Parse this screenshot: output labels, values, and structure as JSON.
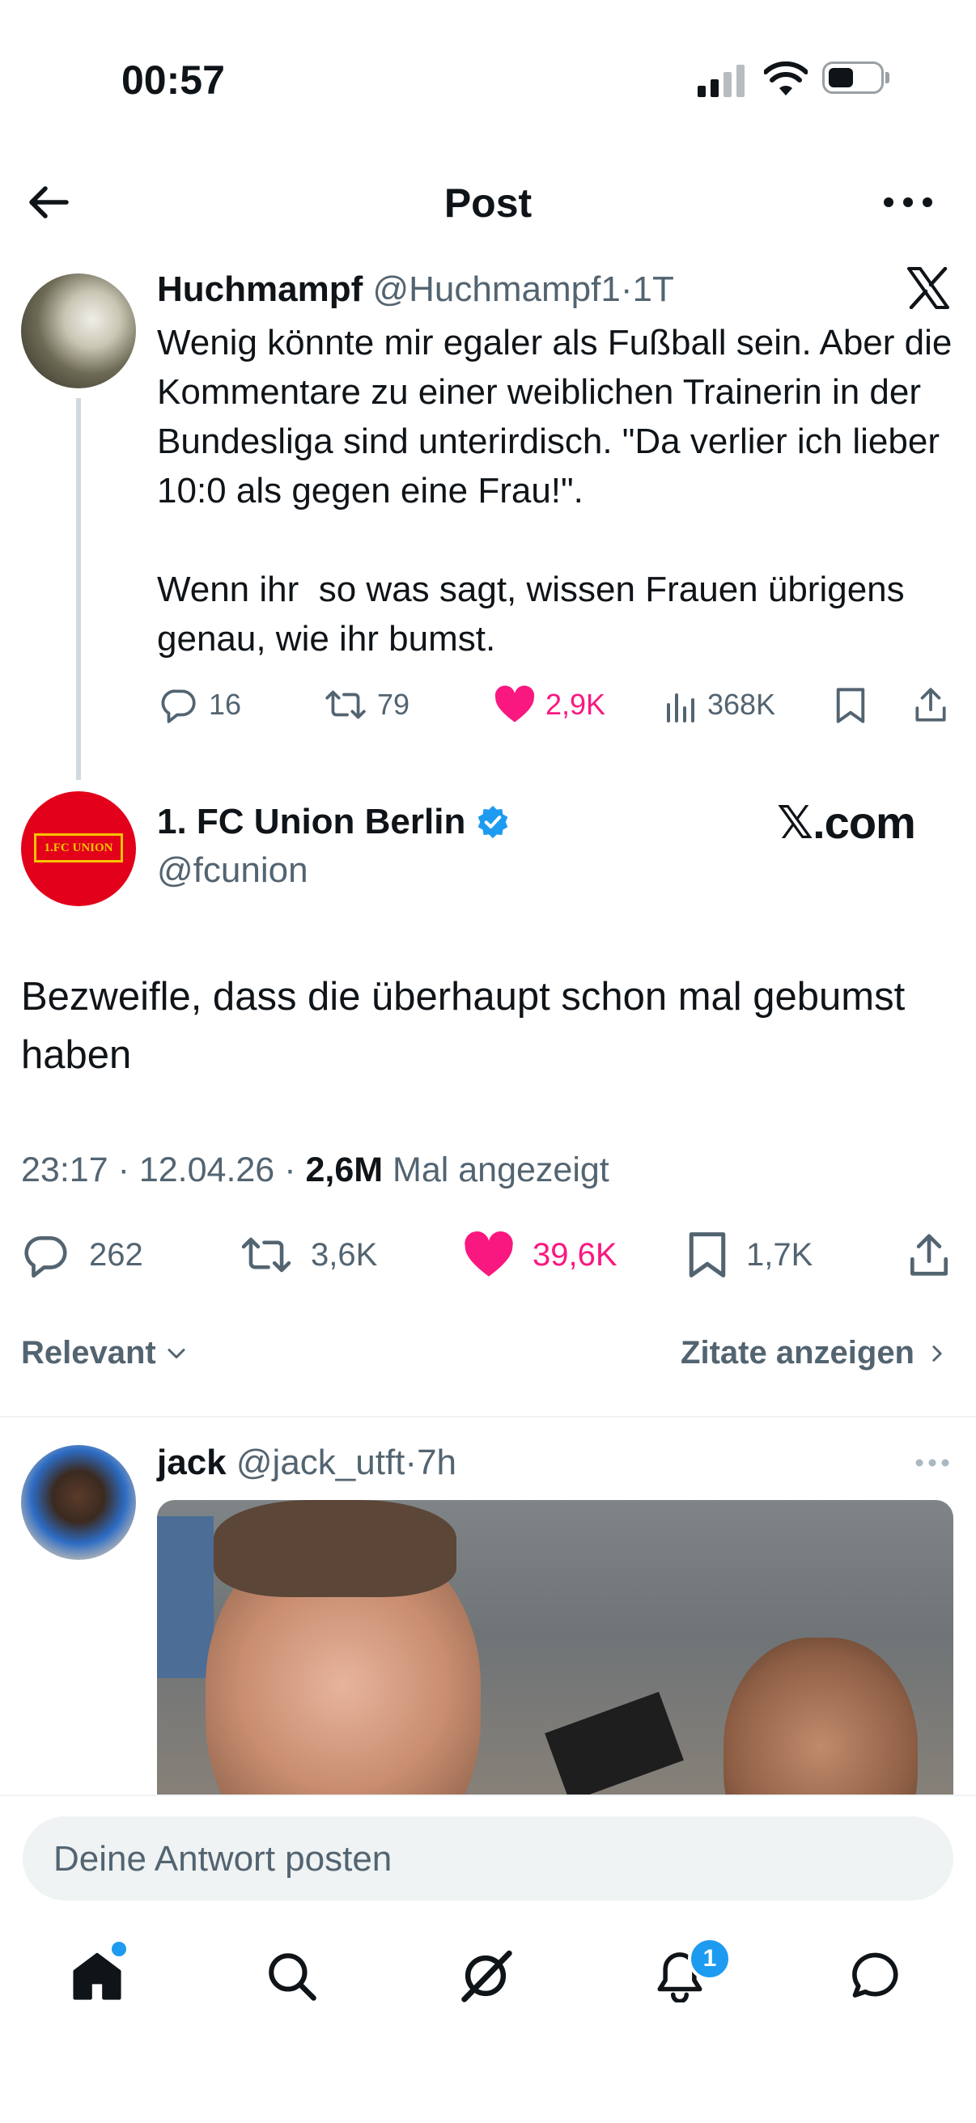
{
  "status_bar": {
    "time": "00:57"
  },
  "header": {
    "title": "Post"
  },
  "quoted_tweet": {
    "name": "Huchmampf",
    "handle": "@Huchmampf1",
    "dot": "·",
    "age": "1T",
    "text": "Wenig könnte mir egaler als Fußball sein. Aber die Kommentare zu einer weiblichen Trainerin in der Bundesliga sind unterirdisch. \"Da verlier ich lieber 10:0 als gegen eine Frau!\".\n\nWenn ihr  so was sagt, wissen Frauen übrigens genau, wie ihr bumst.",
    "replies": "16",
    "reposts": "79",
    "likes": "2,9K",
    "views": "368K"
  },
  "main_tweet": {
    "name": "1. FC Union Berlin",
    "handle": "@fcunion",
    "watermark": "𝕏.com",
    "avatar_text": "1.FC UNION",
    "text": "Bezweifle, dass die überhaupt schon mal gebumst haben",
    "time": "23:17",
    "date": "12.04.26",
    "views": "2,6M",
    "views_label": "Mal angezeigt",
    "sep": "·",
    "replies": "262",
    "reposts": "3,6K",
    "likes": "39,6K",
    "bookmarks": "1,7K"
  },
  "filters": {
    "sort": "Relevant",
    "quotes": "Zitate anzeigen"
  },
  "reply": {
    "name": "jack",
    "handle": "@jack_utft",
    "dot": "·",
    "age": "7h"
  },
  "compose": {
    "placeholder": "Deine Antwort posten"
  },
  "tabbar": {
    "notifications_badge": "1"
  },
  "colors": {
    "like": "#f91880",
    "verified": "#1d9bf0",
    "union_red": "#e2001a",
    "text": "#0f1419",
    "muted": "#536471"
  }
}
